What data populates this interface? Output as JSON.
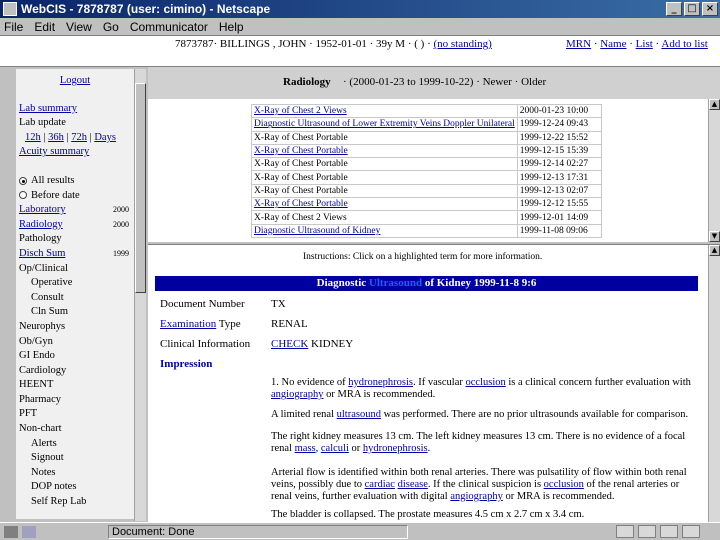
{
  "window": {
    "title": "WebCIS - 7878787 (user: cimino) - Netscape",
    "min": "_",
    "max": "□",
    "close": "×"
  },
  "menu": [
    "File",
    "Edit",
    "View",
    "Go",
    "Communicator",
    "Help"
  ],
  "patient": {
    "id_name": "7873787· BILLINGS , JOHN",
    "details": "· 1952-01-01 · 39y M · ( ) ·",
    "no_standing": "(no standing)",
    "mrn": "MRN",
    "sep1": "·",
    "name": "Name",
    "sep2": "·",
    "list": "List",
    "sep3": "·",
    "add_to_list": "Add to list"
  },
  "sidebar": {
    "logout": "Logout",
    "lab_summary": "Lab summary",
    "lab_update": "Lab update",
    "t12h": "12h",
    "t36h": "36h",
    "t72h": "72h",
    "days": "Days",
    "acuity": "Acuity summary",
    "all_results": "All results",
    "before_date": "Before date",
    "items": [
      {
        "label": "Laboratory",
        "count": "2000",
        "link": true
      },
      {
        "label": "Radiology",
        "count": "2000",
        "link": true
      },
      {
        "label": "Pathology",
        "count": "",
        "link": false
      },
      {
        "label": "Disch Sum",
        "count": "1999",
        "link": true
      },
      {
        "label": "Op/Clinical",
        "count": "",
        "link": false
      },
      {
        "label": "Operative",
        "count": "",
        "link": false,
        "indent": true
      },
      {
        "label": "Consult",
        "count": "",
        "link": false,
        "indent": true
      },
      {
        "label": "Cln Sum",
        "count": "",
        "link": false,
        "indent": true
      },
      {
        "label": "Neurophys",
        "count": "",
        "link": false
      },
      {
        "label": "Ob/Gyn",
        "count": "",
        "link": false
      },
      {
        "label": "GI Endo",
        "count": "",
        "link": false
      },
      {
        "label": "Cardiology",
        "count": "",
        "link": false
      },
      {
        "label": "HEENT",
        "count": "",
        "link": false
      },
      {
        "label": "Pharmacy",
        "count": "",
        "link": false
      },
      {
        "label": "PFT",
        "count": "",
        "link": false
      },
      {
        "label": "Non-chart",
        "count": "",
        "link": false
      },
      {
        "label": "Alerts",
        "count": "",
        "link": false,
        "indent": true
      },
      {
        "label": "Signout",
        "count": "",
        "link": false,
        "indent": true
      },
      {
        "label": "Notes",
        "count": "",
        "link": false,
        "indent": true
      },
      {
        "label": "DOP notes",
        "count": "",
        "link": false,
        "indent": true
      },
      {
        "label": "Self Rep Lab",
        "count": "",
        "link": false,
        "indent": true
      }
    ]
  },
  "radiology": {
    "title": "Radiology",
    "nav": "· (2000-01-23 to 1999-10-22) · Newer · Older",
    "exams": [
      {
        "name": "X-Ray of Chest 2 Views",
        "date": "2000-01-23 10:00",
        "link": true
      },
      {
        "name": "Diagnostic Ultrasound of Lower Extremity Veins Doppler Unilateral",
        "date": "1999-12-24 09:43",
        "link": true
      },
      {
        "name": "X-Ray of Chest Portable",
        "date": "1999-12-22 15:52",
        "link": false
      },
      {
        "name": "X-Ray of Chest Portable",
        "date": "1999-12-15 15:39",
        "link": true
      },
      {
        "name": "X-Ray of Chest Portable",
        "date": "1999-12-14 02:27",
        "link": false
      },
      {
        "name": "X-Ray of Chest Portable",
        "date": "1999-12-13 17:31",
        "link": false
      },
      {
        "name": "X-Ray of Chest Portable",
        "date": "1999-12-13 02:07",
        "link": false
      },
      {
        "name": "X-Ray of Chest Portable",
        "date": "1999-12-12 15:55",
        "link": true
      },
      {
        "name": "X-Ray of Chest 2 Views",
        "date": "1999-12-01 14:09",
        "link": false
      },
      {
        "name": "Diagnostic Ultrasound of Kidney",
        "date": "1999-11-08 09:06",
        "link": true
      }
    ]
  },
  "report": {
    "instructions": "Instructions: Click on a highlighted term for more information.",
    "head_pre": "Diagnostic",
    "head_hl": "Ultrasound",
    "head_post": "of Kidney 1999-11-8 9:6",
    "doc_number_label": "Document Number",
    "doc_number_value": "TX",
    "exam_link": "Examination",
    "type_label": "Type",
    "type_value": "RENAL",
    "clinical_label": "Clinical Information",
    "clinical_link": "CHECK",
    "clinical_value": "KIDNEY",
    "impression": "Impression",
    "p1_a": "1. No evidence of ",
    "p1_l1": "hydronephrosis",
    "p1_b": ". If vascular ",
    "p1_l2": "occlusion",
    "p1_c": " is a clinical concern further evaluation with ",
    "p1_l3": "angiography",
    "p1_d": " or MRA is recommended.",
    "p2_a": "A limited renal ",
    "p2_l1": "ultrasound",
    "p2_b": " was performed. There are no prior ultrasounds available for comparison.",
    "p3_a": "The right kidney measures 13 cm. The left kidney measures 13 cm. There is no evidence of a focal renal ",
    "p3_l1": "mass",
    "p3_b": ", ",
    "p3_l2": "calculi",
    "p3_c": " or ",
    "p3_l3": "hydronephrosis",
    "p3_d": ".",
    "p4_a": "Arterial flow is identified within both renal arteries. There was pulsatility of flow within both renal veins, possibly due to ",
    "p4_l1": "cardiac",
    "p4_b": " ",
    "p4_l2": "disease",
    "p4_c": ". If the clinical suspicion is ",
    "p4_l3": "occlusion",
    "p4_d": " of the renal arteries or renal veins, further evaluation with digital ",
    "p4_l4": "angiography",
    "p4_e": " or MRA is recommended.",
    "p5": "The bladder is collapsed. The prostate measures 4.5 cm x 2.7 cm x 3.4 cm."
  },
  "status": {
    "text": "Document: Done"
  }
}
